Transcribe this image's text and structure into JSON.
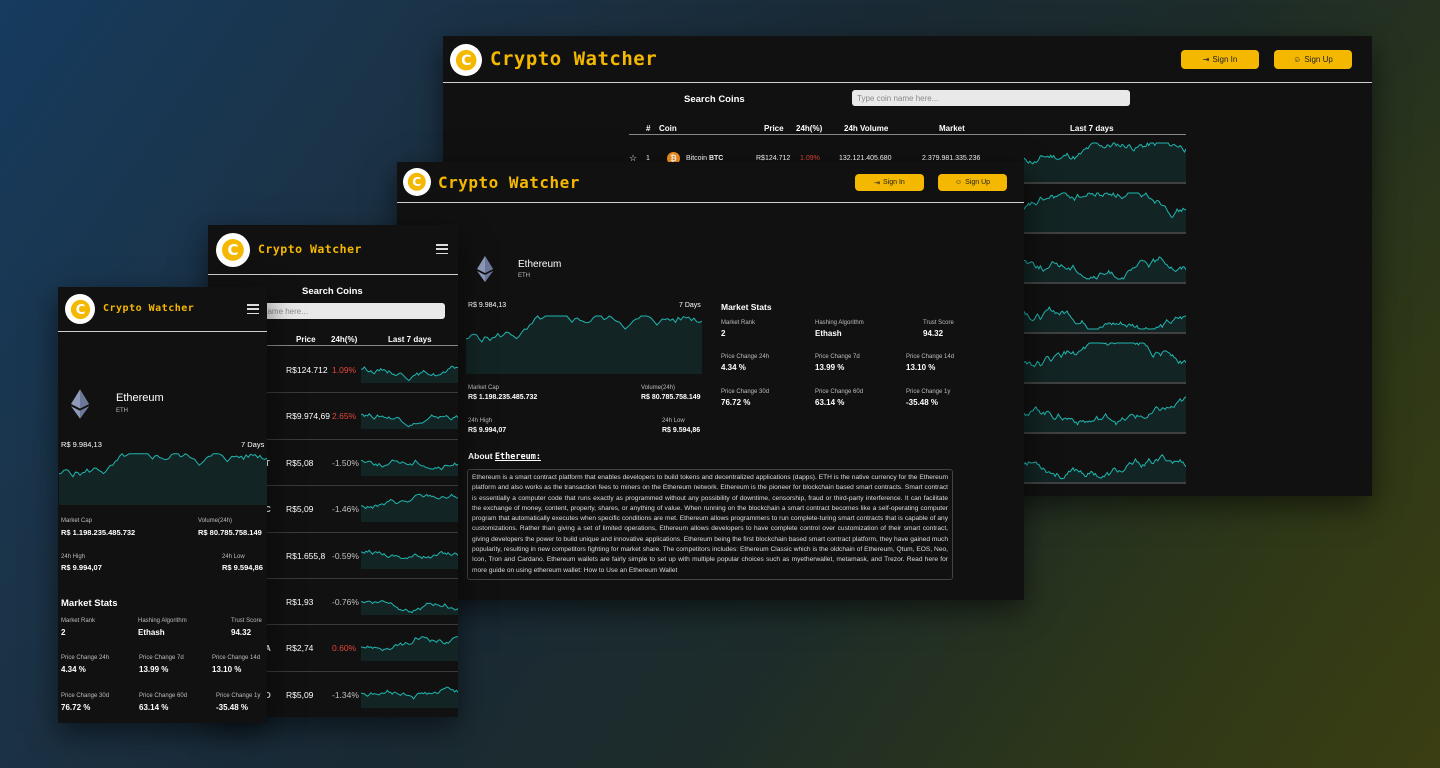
{
  "app": {
    "brand": "Crypto Watcher",
    "sign_in": "Sign In",
    "sign_up": "Sign Up"
  },
  "colors": {
    "accent": "#f5b800",
    "negative": "#e0473a",
    "sparkline": "#1fb6b0",
    "panel": "#111111"
  },
  "search": {
    "title": "Search Coins",
    "placeholder": "Type coin name here...",
    "placeholder_cut": "name here..."
  },
  "table": {
    "headers": {
      "rank": "#",
      "coin": "Coin",
      "price": "Price",
      "change": "24h(%)",
      "volume": "24h Volume",
      "market": "Market",
      "last7": "Last 7 days"
    },
    "first_row": {
      "rank": "1",
      "name": "Bitcoin",
      "symbol": "BTC",
      "price": "R$124.712",
      "change": "1.09%",
      "volume": "132.121.405.680",
      "market": "2.379.981.335.236"
    },
    "tablet_rows": [
      {
        "tail": "",
        "price": "R$124.712",
        "change": "1.09%"
      },
      {
        "tail": "",
        "price": "R$9.974,69",
        "change": "2.65%"
      },
      {
        "tail": "T",
        "price": "R$5,08",
        "change": "-1.50%"
      },
      {
        "tail": "C",
        "price": "R$5,09",
        "change": "-1.46%"
      },
      {
        "tail": "",
        "price": "R$1.655,8",
        "change": "-0.59%"
      },
      {
        "tail": "",
        "price": "R$1,93",
        "change": "-0.76%"
      },
      {
        "tail": "A",
        "price": "R$2,74",
        "change": "0.60%"
      },
      {
        "tail": "D",
        "price": "R$5,09",
        "change": "-1.34%"
      }
    ]
  },
  "coin": {
    "name": "Ethereum",
    "symbol": "ETH",
    "current_price": "R$ 9.984,13",
    "period": "7 Days",
    "market_cap_label": "Market Cap",
    "market_cap": "R$ 1.198.235.485.732",
    "volume_label": "Volume(24h)",
    "volume": "R$ 80.785.758.149",
    "high_label": "24h High",
    "high": "R$ 9.994,07",
    "low_label": "24h Low",
    "low": "R$ 9.594,86",
    "stats_title": "Market Stats",
    "stats": [
      {
        "label": "Market Rank",
        "value": "2"
      },
      {
        "label": "Hashing Algorithm",
        "value": "Ethash"
      },
      {
        "label": "Trust Score",
        "value": "94.32"
      },
      {
        "label": "Price Change 24h",
        "value": "4.34 %"
      },
      {
        "label": "Price Change 7d",
        "value": "13.99 %"
      },
      {
        "label": "Price Change 14d",
        "value": "13.10 %"
      },
      {
        "label": "Price Change 30d",
        "value": "76.72 %"
      },
      {
        "label": "Price Change 60d",
        "value": "63.14 %"
      },
      {
        "label": "Price Change 1y",
        "value": "-35.48 %"
      }
    ],
    "about_prefix": "About",
    "about_name": "Ethereum:",
    "about_text": "Ethereum is a smart contract platform that enables developers to build tokens and decentralized applications (dapps). ETH is the native currency for the Ethereum platform and also works as the transaction fees to miners on the Ethereum network. Ethereum is the pioneer for blockchain based smart contracts. Smart contract is essentially a computer code that runs exactly as programmed without any possibility of downtime, censorship, fraud or third-party interference. It can facilitate the exchange of money, content, property, shares, or anything of value. When running on the blockchain a smart contract becomes like a self-operating computer program that automatically executes when specific conditions are met. Ethereum allows programmers to run complete-turing smart contracts that is capable of any customizations. Rather than giving a set of limited operations, Ethereum allows developers to have complete control over customization of their smart contract, giving developers the power to build unique and innovative applications. Ethereum being the first blockchain based smart contract platform, they have gained much popularity, resulting in new competitors fighting for market share. The competitors includes: Ethereum Classic which is the oldchain of Ethereum, Qtum, EOS, Neo, Icon, Tron and Cardano. Ethereum wallets are fairly simple to set up with multiple popular choices such as myetherwallet, metamask, and Trezor. Read here for more guide on using ethereum wallet: How to Use an Ethereum Wallet"
  }
}
